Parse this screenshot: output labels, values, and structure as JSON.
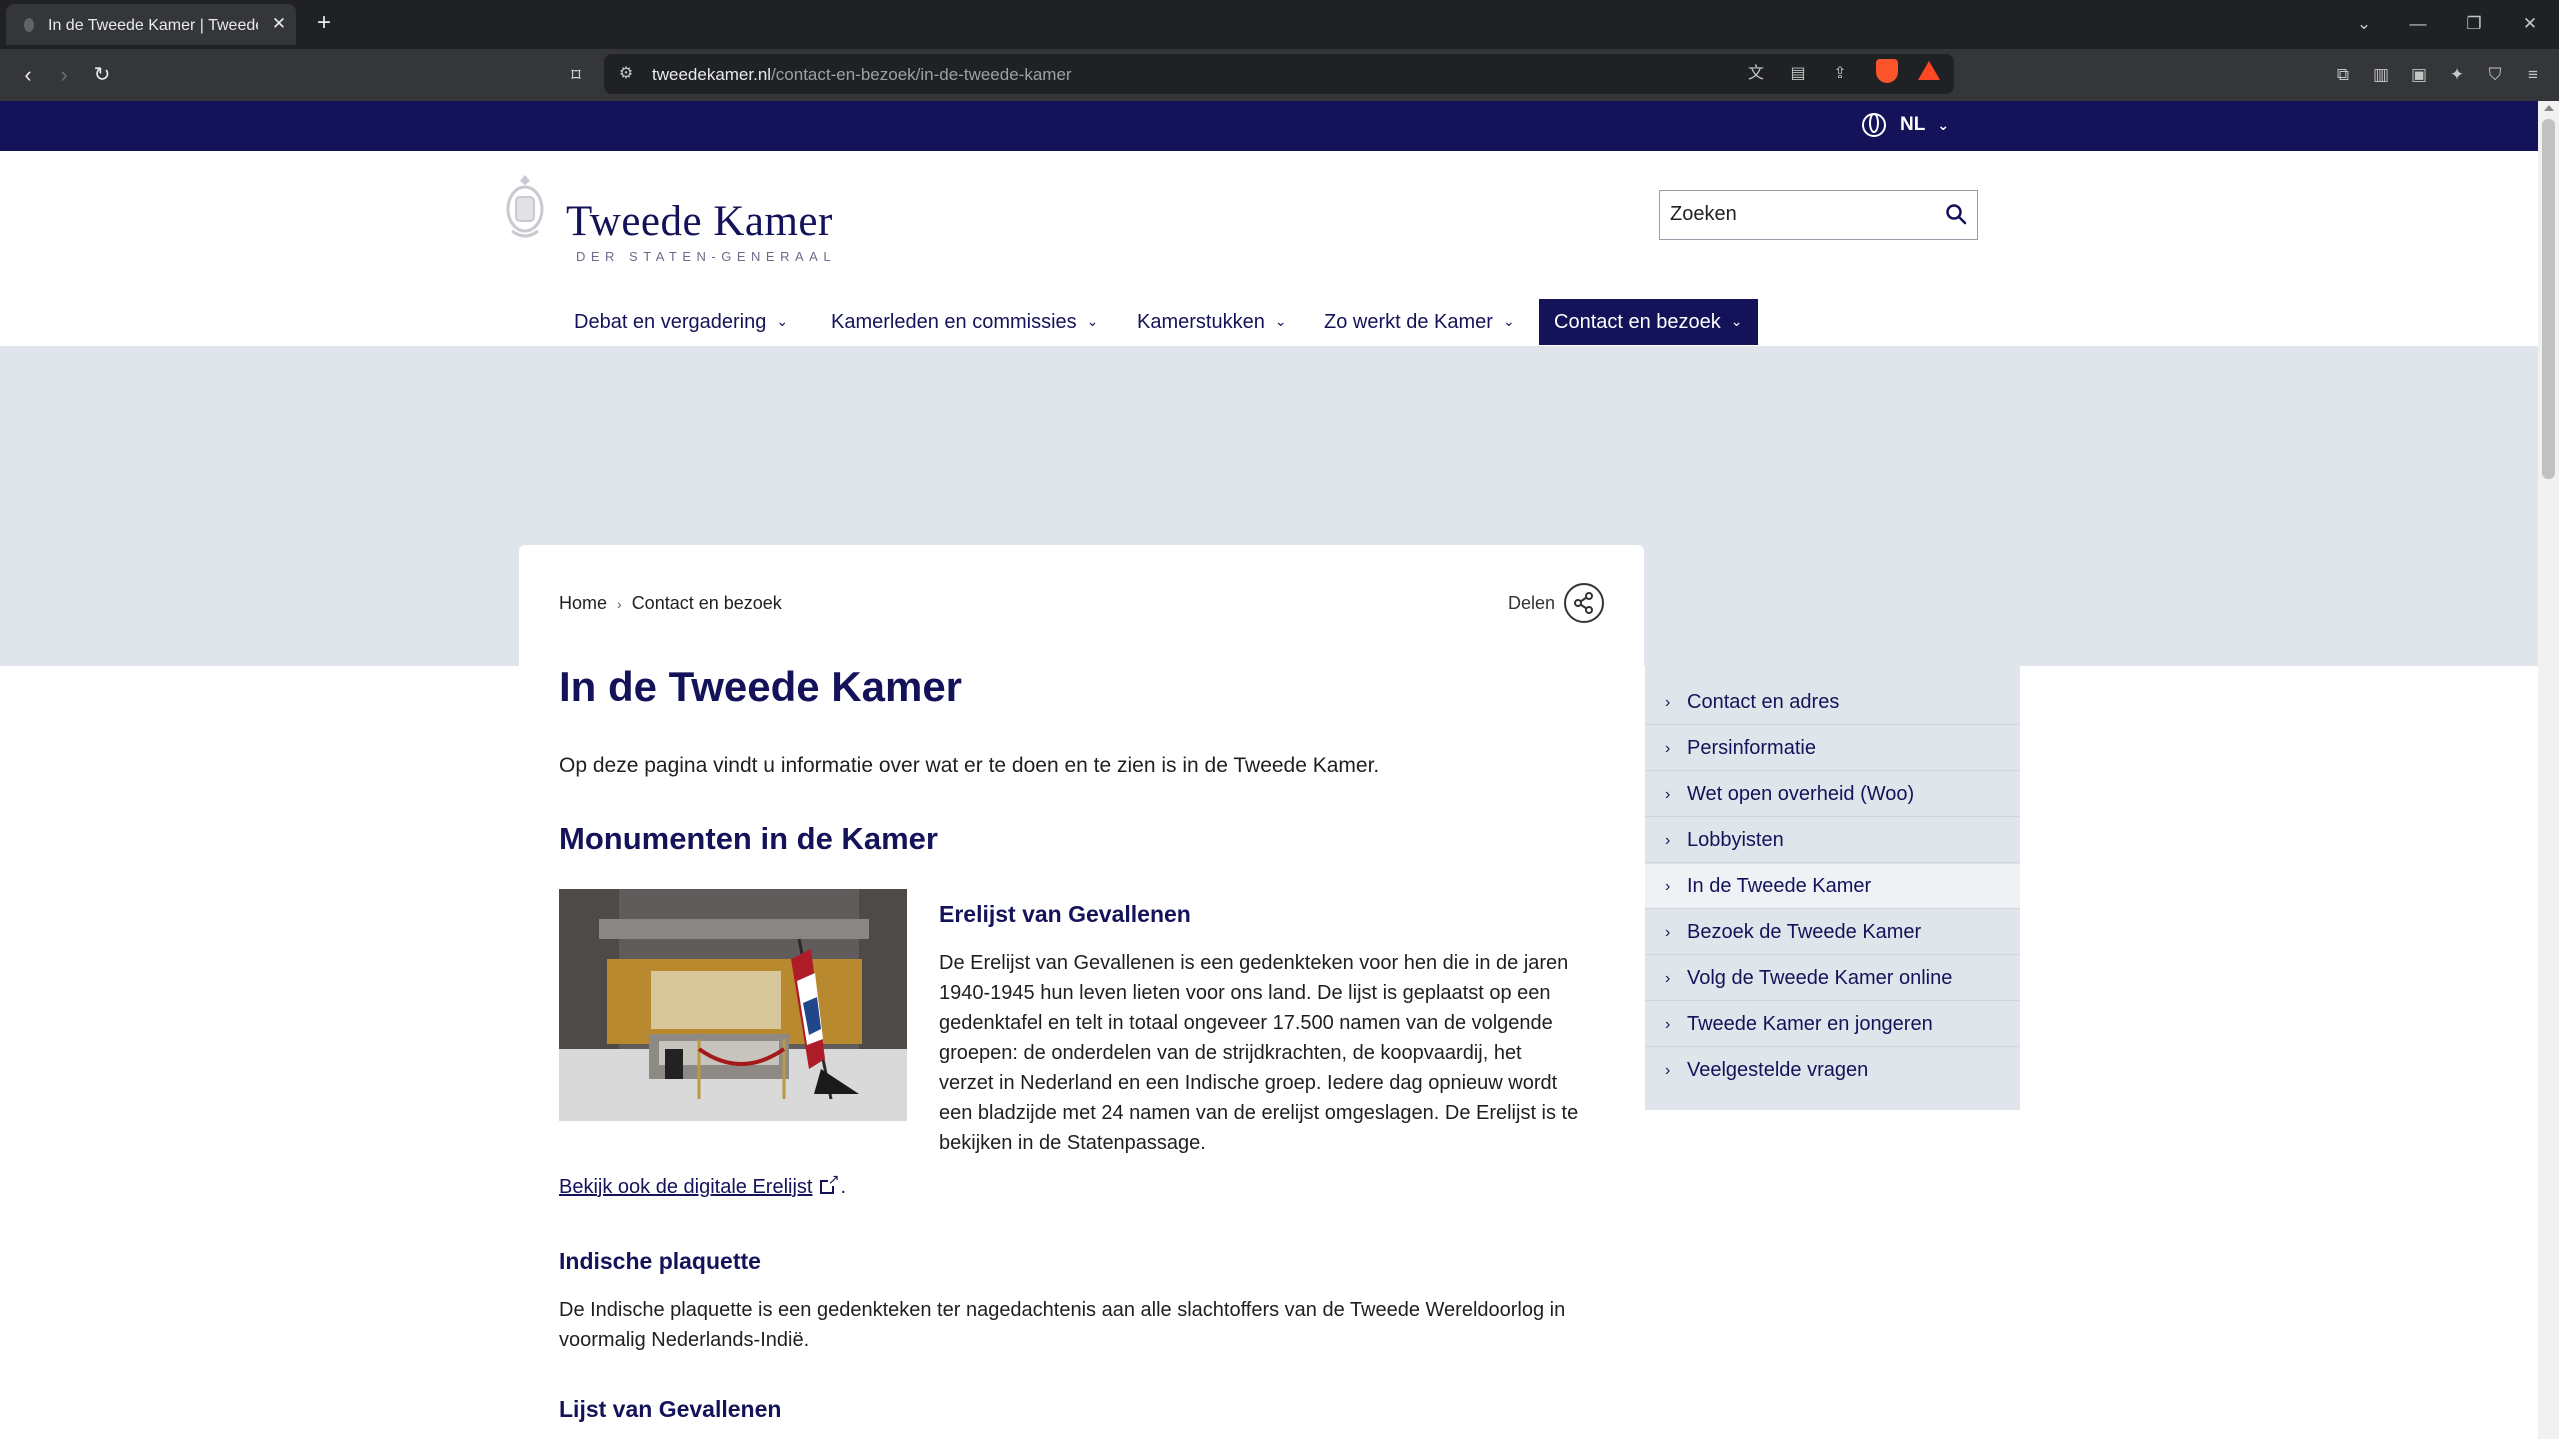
{
  "browser": {
    "tab_title": "In de Tweede Kamer | Tweede Kamer der Staten-Generaal",
    "tab_close": "✕",
    "new_tab": "+",
    "url_host": "tweedekamer.nl",
    "url_path": "/contact-en-bezoek/in-de-tweede-kamer"
  },
  "site": {
    "language": "NL",
    "logo": {
      "name": "Tweede Kamer",
      "subtitle": "DER STATEN-GENERAAL"
    },
    "search_placeholder": "Zoeken",
    "nav": [
      {
        "label": "Debat en vergadering"
      },
      {
        "label": "Kamerleden en commissies"
      },
      {
        "label": "Kamerstukken"
      },
      {
        "label": "Zo werkt de Kamer"
      },
      {
        "label": "Contact en bezoek"
      }
    ]
  },
  "page": {
    "breadcrumb": [
      "Home",
      "Contact en bezoek"
    ],
    "share_label": "Delen",
    "title": "In de Tweede Kamer",
    "intro": "Op deze pagina vindt u informatie over wat er te doen en te zien is in de Tweede Kamer.",
    "section_title": "Monumenten in de Kamer",
    "erelijst": {
      "heading": "Erelijst van Gevallenen",
      "lines": [
        "De Erelijst van Gevallenen is een gedenkteken voor hen die in de jaren",
        "1940-1945 hun leven lieten voor ons land. De lijst is geplaatst op een",
        "gedenktafel en telt in totaal ongeveer 17.500 namen van de volgende",
        "groepen: de onderdelen van de strijdkrachten, de koopvaardij, het",
        "verzet in Nederland en een Indische groep. Iedere dag opnieuw wordt",
        "een bladzijde met 24 namen van de erelijst omgeslagen. De Erelijst is te",
        "bekijken in de Statenpassage."
      ]
    },
    "digital_link": "Bekijk ook de digitale Erelijst",
    "digital_link_suffix": ".",
    "plaquette": {
      "heading": "Indische plaquette",
      "lines": [
        "De Indische plaquette is een gedenkteken ter nagedachtenis aan alle slachtoffers van de Tweede Wereldoorlog in",
        "voormalig Nederlands-Indië."
      ]
    },
    "next_heading": "Lijst van Gevallenen"
  },
  "sidebar": {
    "items": [
      {
        "label": "Contact en adres"
      },
      {
        "label": "Persinformatie"
      },
      {
        "label": "Wet open overheid (Woo)"
      },
      {
        "label": "Lobbyisten"
      },
      {
        "label": "In de Tweede Kamer"
      },
      {
        "label": "Bezoek de Tweede Kamer"
      },
      {
        "label": "Volg de Tweede Kamer online"
      },
      {
        "label": "Tweede Kamer en jongeren"
      },
      {
        "label": "Veelgestelde vragen"
      }
    ]
  },
  "colors": {
    "brand": "#14135a",
    "banner": "#dfe5ea"
  }
}
